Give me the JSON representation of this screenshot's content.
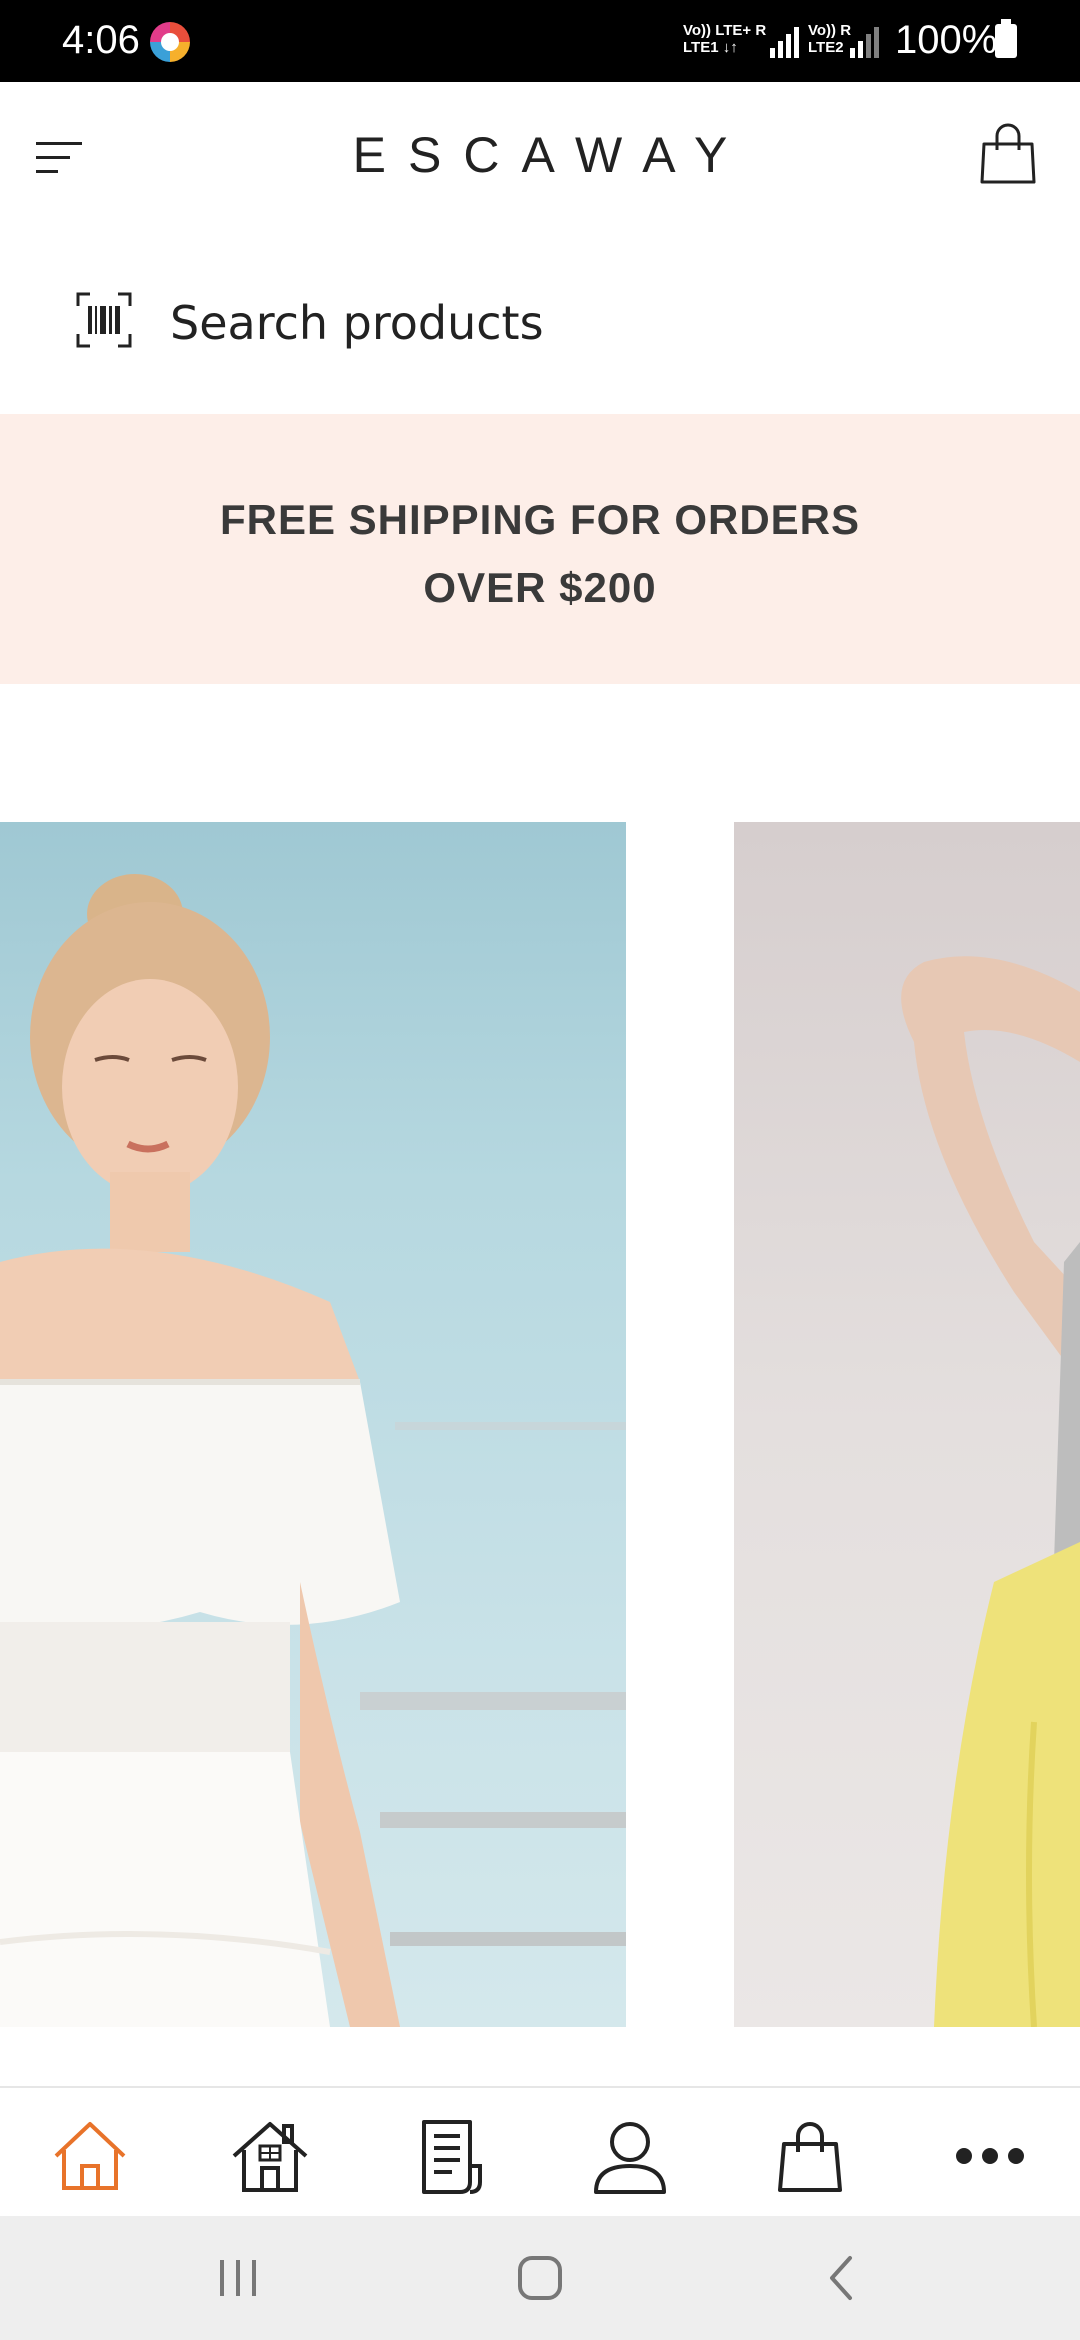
{
  "status_bar": {
    "time": "4:06",
    "sim1": "Vo)) LTE+ R\nLTE1 ↓↑",
    "sim2": "Vo)) R\nLTE2",
    "battery": "100%"
  },
  "header": {
    "brand": "ESCAWAY",
    "menu_icon": "menu-icon",
    "cart_icon": "shopping-bag-icon"
  },
  "search": {
    "placeholder": "Search products",
    "icon": "barcode-scan-icon"
  },
  "promo": {
    "line1": "FREE SHIPPING FOR ORDERS",
    "line2": "OVER $200",
    "background": "#fdeee8"
  },
  "carousel": {
    "slides": [
      {
        "description": "woman-in-white-off-shoulder-dress"
      },
      {
        "description": "woman-in-yellow-pants"
      }
    ]
  },
  "bottom_nav": {
    "active_color": "#e8732a",
    "items": [
      {
        "icon": "home-outline-icon",
        "active": true
      },
      {
        "icon": "house-icon",
        "active": false
      },
      {
        "icon": "document-icon",
        "active": false
      },
      {
        "icon": "user-icon",
        "active": false
      },
      {
        "icon": "shopping-bag-icon",
        "active": false
      },
      {
        "icon": "more-icon",
        "active": false
      }
    ]
  },
  "system_nav": {
    "items": [
      "recent-apps-icon",
      "home-icon",
      "back-icon"
    ]
  }
}
